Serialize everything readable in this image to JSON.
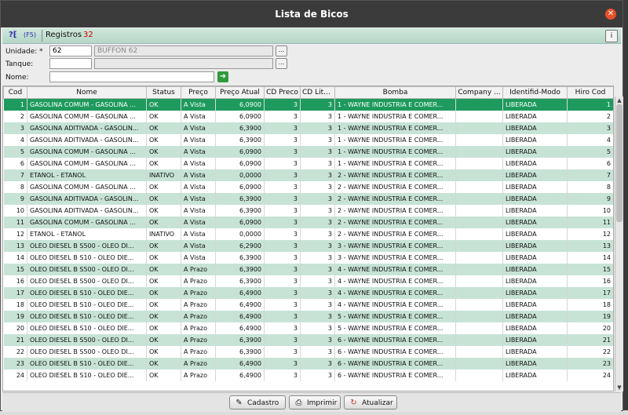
{
  "window": {
    "title": "Lista de Bicos",
    "close_glyph": "✕"
  },
  "toolbar": {
    "help_glyph": "?⁅",
    "refresh_hint": "(F5)",
    "records_label": "Registros",
    "records_count": "32",
    "info_glyph": "i"
  },
  "filters": {
    "unidade": {
      "label": "Unidade: *",
      "code": "62",
      "name": "BUFFON 62"
    },
    "tanque": {
      "label": "Tanque:",
      "code": "",
      "name": ""
    },
    "nome": {
      "label": "Nome:",
      "value": ""
    },
    "lookup_glyph": "...",
    "go_glyph": "➜"
  },
  "grid": {
    "columns": [
      "Cod",
      "Nome",
      "Status",
      "Preço",
      "Preço Atual",
      "CD Preco",
      "CD Litros",
      "Bomba",
      "Company ...",
      "Identifid-Modo",
      "Hiro Cod"
    ],
    "rows": [
      [
        "1",
        "GASOLINA COMUM - GASOLINA ...",
        "OK",
        "A Vista",
        "6,0900",
        "3",
        "3",
        "1 - WAYNE INDUSTRIA E COMER...",
        "",
        "LIBERADA",
        "1"
      ],
      [
        "2",
        "GASOLINA COMUM - GASOLINA ...",
        "OK",
        "A Vista",
        "6,0900",
        "3",
        "3",
        "1 - WAYNE INDUSTRIA E COMER...",
        "",
        "LIBERADA",
        "2"
      ],
      [
        "3",
        "GASOLINA ADITIVADA - GASOLIN...",
        "OK",
        "A Vista",
        "6,3900",
        "3",
        "3",
        "1 - WAYNE INDUSTRIA E COMER...",
        "",
        "LIBERADA",
        "3"
      ],
      [
        "4",
        "GASOLINA ADITIVADA - GASOLIN...",
        "OK",
        "A Vista",
        "6,3900",
        "3",
        "3",
        "1 - WAYNE INDUSTRIA E COMER...",
        "",
        "LIBERADA",
        "4"
      ],
      [
        "5",
        "GASOLINA COMUM - GASOLINA ...",
        "OK",
        "A Vista",
        "6,0900",
        "3",
        "3",
        "1 - WAYNE INDUSTRIA E COMER...",
        "",
        "LIBERADA",
        "5"
      ],
      [
        "6",
        "GASOLINA COMUM - GASOLINA ...",
        "OK",
        "A Vista",
        "6,0900",
        "3",
        "3",
        "1 - WAYNE INDUSTRIA E COMER...",
        "",
        "LIBERADA",
        "6"
      ],
      [
        "7",
        "ETANOL - ETANOL",
        "INATIVO",
        "A Vista",
        "0,0000",
        "3",
        "3",
        "2 - WAYNE INDUSTRIA E COMER...",
        "",
        "LIBERADA",
        "7"
      ],
      [
        "8",
        "GASOLINA COMUM - GASOLINA ...",
        "OK",
        "A Vista",
        "6,0900",
        "3",
        "3",
        "2 - WAYNE INDUSTRIA E COMER...",
        "",
        "LIBERADA",
        "8"
      ],
      [
        "9",
        "GASOLINA ADITIVADA - GASOLIN...",
        "OK",
        "A Vista",
        "6,3900",
        "3",
        "3",
        "2 - WAYNE INDUSTRIA E COMER...",
        "",
        "LIBERADA",
        "9"
      ],
      [
        "10",
        "GASOLINA ADITIVADA - GASOLIN...",
        "OK",
        "A Vista",
        "6,3900",
        "3",
        "3",
        "2 - WAYNE INDUSTRIA E COMER...",
        "",
        "LIBERADA",
        "10"
      ],
      [
        "11",
        "GASOLINA COMUM - GASOLINA ...",
        "OK",
        "A Vista",
        "6,0900",
        "3",
        "3",
        "2 - WAYNE INDUSTRIA E COMER...",
        "",
        "LIBERADA",
        "11"
      ],
      [
        "12",
        "ETANOL - ETANOL",
        "INATIVO",
        "A Vista",
        "0,0000",
        "3",
        "3",
        "2 - WAYNE INDUSTRIA E COMER...",
        "",
        "LIBERADA",
        "12"
      ],
      [
        "13",
        "OLEO DIESEL B S500 - OLEO DI...",
        "OK",
        "A Vista",
        "6,2900",
        "3",
        "3",
        "3 - WAYNE INDUSTRIA E COMER...",
        "",
        "LIBERADA",
        "13"
      ],
      [
        "14",
        "OLEO DIESEL B S10 - OLEO DIE...",
        "OK",
        "A Vista",
        "6,3900",
        "3",
        "3",
        "3 - WAYNE INDUSTRIA E COMER...",
        "",
        "LIBERADA",
        "14"
      ],
      [
        "15",
        "OLEO DIESEL B S500 - OLEO DI...",
        "OK",
        "A Prazo",
        "6,3900",
        "3",
        "3",
        "4 - WAYNE INDUSTRIA E COMER...",
        "",
        "LIBERADA",
        "15"
      ],
      [
        "16",
        "OLEO DIESEL B S500 - OLEO DI...",
        "OK",
        "A Prazo",
        "6,3900",
        "3",
        "3",
        "4 - WAYNE INDUSTRIA E COMER...",
        "",
        "LIBERADA",
        "16"
      ],
      [
        "17",
        "OLEO DIESEL B S10 - OLEO DIE...",
        "OK",
        "A Prazo",
        "6,4900",
        "3",
        "3",
        "4 - WAYNE INDUSTRIA E COMER...",
        "",
        "LIBERADA",
        "17"
      ],
      [
        "18",
        "OLEO DIESEL B S10 - OLEO DIE...",
        "OK",
        "A Prazo",
        "6,4900",
        "3",
        "3",
        "4 - WAYNE INDUSTRIA E COMER...",
        "",
        "LIBERADA",
        "18"
      ],
      [
        "19",
        "OLEO DIESEL B S10 - OLEO DIE...",
        "OK",
        "A Prazo",
        "6,4900",
        "3",
        "3",
        "5 - WAYNE INDUSTRIA E COMER...",
        "",
        "LIBERADA",
        "19"
      ],
      [
        "20",
        "OLEO DIESEL B S10 - OLEO DIE...",
        "OK",
        "A Prazo",
        "6,4900",
        "3",
        "3",
        "5 - WAYNE INDUSTRIA E COMER...",
        "",
        "LIBERADA",
        "20"
      ],
      [
        "21",
        "OLEO DIESEL B S500 - OLEO DI...",
        "OK",
        "A Prazo",
        "6,3900",
        "3",
        "3",
        "6 - WAYNE INDUSTRIA E COMER...",
        "",
        "LIBERADA",
        "21"
      ],
      [
        "22",
        "OLEO DIESEL B S500 - OLEO DI...",
        "OK",
        "A Prazo",
        "6,3900",
        "3",
        "3",
        "6 - WAYNE INDUSTRIA E COMER...",
        "",
        "LIBERADA",
        "22"
      ],
      [
        "23",
        "OLEO DIESEL B S10 - OLEO DIE...",
        "OK",
        "A Prazo",
        "6,4900",
        "3",
        "3",
        "6 - WAYNE INDUSTRIA E COMER...",
        "",
        "LIBERADA",
        "23"
      ],
      [
        "24",
        "OLEO DIESEL B S10 - OLEO DIE...",
        "OK",
        "A Prazo",
        "6,4900",
        "3",
        "3",
        "6 - WAYNE INDUSTRIA E COMER...",
        "",
        "LIBERADA",
        "24"
      ]
    ]
  },
  "buttons": {
    "cadastro": {
      "label": "Cadastro",
      "icon": "pencil-icon",
      "glyph": "✎"
    },
    "imprimir": {
      "label": "Imprimir",
      "icon": "printer-icon",
      "glyph": "⎙"
    },
    "atualizar": {
      "label": "Atualizar",
      "icon": "refresh-icon",
      "glyph": "↻"
    }
  },
  "colors": {
    "selected_row": "#1f9a5e",
    "alt_row": "#c6e3d6",
    "titlebar": "#3b3b3b",
    "close": "#e6502b"
  }
}
